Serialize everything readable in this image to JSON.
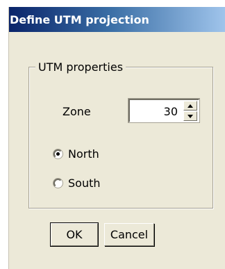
{
  "window": {
    "title": "Define UTM projection"
  },
  "group": {
    "label": "UTM properties",
    "zone": {
      "label": "Zone",
      "value": "30",
      "up_icon": "triangle-up-icon",
      "down_icon": "triangle-down-icon"
    },
    "hemisphere": {
      "options": [
        {
          "label": "North",
          "checked": true
        },
        {
          "label": "South",
          "checked": false
        }
      ]
    }
  },
  "buttons": {
    "ok_label": "OK",
    "cancel_label": "Cancel"
  },
  "colors": {
    "dialog_bg": "#ece9d8",
    "titlebar_start": "#0a246a",
    "titlebar_end": "#a6caf0",
    "title_text": "#ffffff"
  }
}
